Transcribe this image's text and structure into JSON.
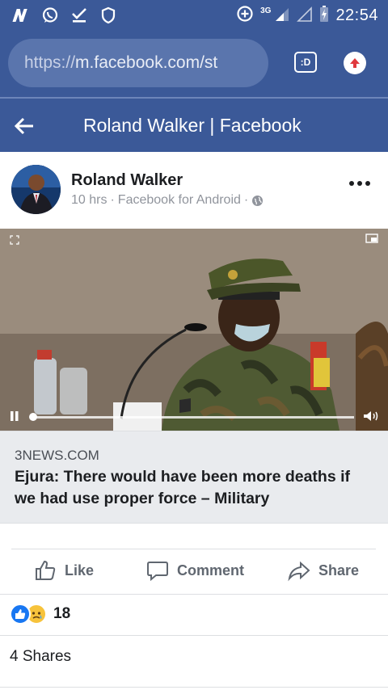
{
  "status_bar": {
    "time": "22:54",
    "network_label": "3G",
    "icons": [
      "n-app-icon",
      "whatsapp-icon",
      "download-done-icon",
      "shield-icon",
      "data-saver-icon",
      "signal-icon",
      "signal-empty-icon",
      "battery-charging-icon"
    ]
  },
  "browser": {
    "url_scheme": "https://",
    "url_rest": "m.facebook.com/st",
    "tab_label": ":D"
  },
  "app_bar": {
    "title": "Roland Walker | Facebook"
  },
  "post": {
    "author": "Roland Walker",
    "time": "10 hrs",
    "source": "Facebook for Android",
    "privacy": "globe-icon",
    "link": {
      "domain": "3NEWS.COM",
      "title": "Ejura: There would have been more deaths if we had use proper force – Military"
    },
    "video": {
      "progress": 0.0,
      "paused": false
    },
    "actions": {
      "like": "Like",
      "comment": "Comment",
      "share": "Share"
    },
    "reactions": {
      "types": [
        "like",
        "sad"
      ],
      "count": "18"
    },
    "shares": "4 Shares"
  },
  "colors": {
    "facebook_blue": "#3b5998",
    "url_field": "#5a75ad",
    "link_bg": "#e9ebee",
    "action_text": "#606770"
  }
}
